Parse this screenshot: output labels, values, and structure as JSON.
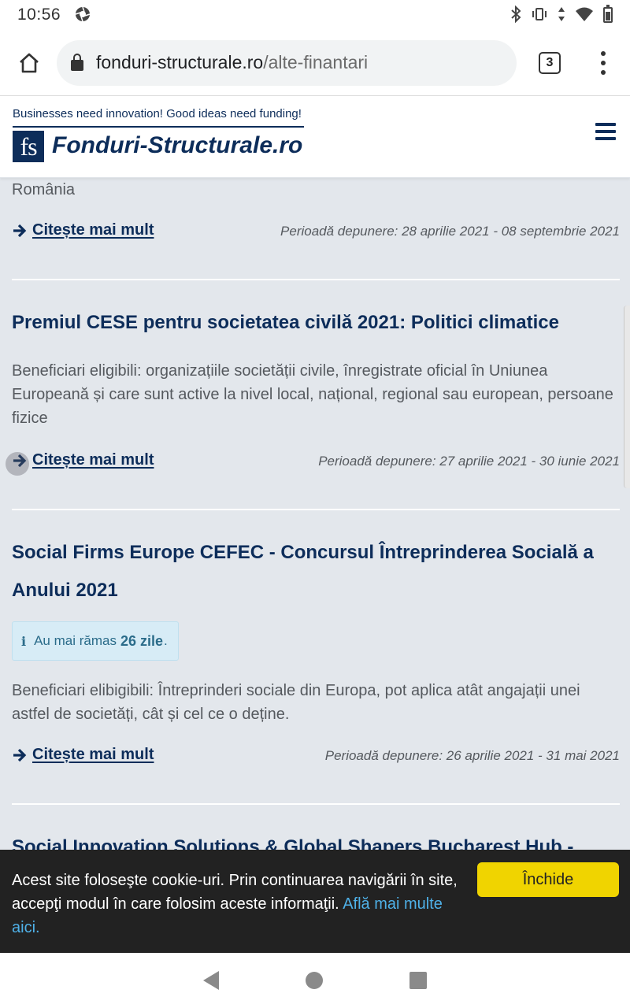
{
  "status_bar": {
    "time": "10:56"
  },
  "browser": {
    "url_host": "fonduri-structurale.ro",
    "url_path": "/alte-finantari",
    "tab_count": "3"
  },
  "site": {
    "tagline": "Businesses need innovation! Good ideas need funding!",
    "logo_mark": "fs",
    "logo_text": "Fonduri-Structurale.ro"
  },
  "listings": [
    {
      "description_tail": "România",
      "read_more": "Citește mai mult",
      "period": "Perioadă depunere: 28 aprilie 2021 - 08 septembrie 2021"
    },
    {
      "title": "Premiul CESE pentru societatea civilă 2021: Politici climatice",
      "description": "Beneficiari eligibili: organizațiile societății civile, înregistrate oficial în Uniunea Europeană și care sunt active la nivel local, național, regional sau european, persoane fizice",
      "read_more": "Citește mai mult",
      "period": "Perioadă depunere: 27 aprilie 2021 - 30 iunie 2021"
    },
    {
      "title": "Social Firms Europe CEFEC - Concursul Întreprinderea Socială a Anului 2021",
      "info_prefix": "Au mai rămas",
      "info_days": "26 zile",
      "info_suffix": ".",
      "description": "Beneficiari elibigibili: Întreprinderi sociale din Europa, pot aplica atât angajații unei astfel de societăți, cât și cel ce o deține.",
      "read_more": "Citește mai mult",
      "period": "Perioadă depunere: 26 aprilie 2021 - 31 mai 2021"
    },
    {
      "title": "Social Innovation Solutions & Global Shapers Bucharest Hub -"
    }
  ],
  "cookie": {
    "text": "Acest site foloseşte cookie-uri. Prin continuarea navigării în site, accepţi modul în care folosim aceste informaţii.",
    "link": "Află mai multe aici.",
    "button": "Închide"
  },
  "colors": {
    "brand": "#0d2d5a",
    "content_bg": "#e3e7ec",
    "cookie_button": "#f0d400",
    "link": "#4fb1e8"
  }
}
